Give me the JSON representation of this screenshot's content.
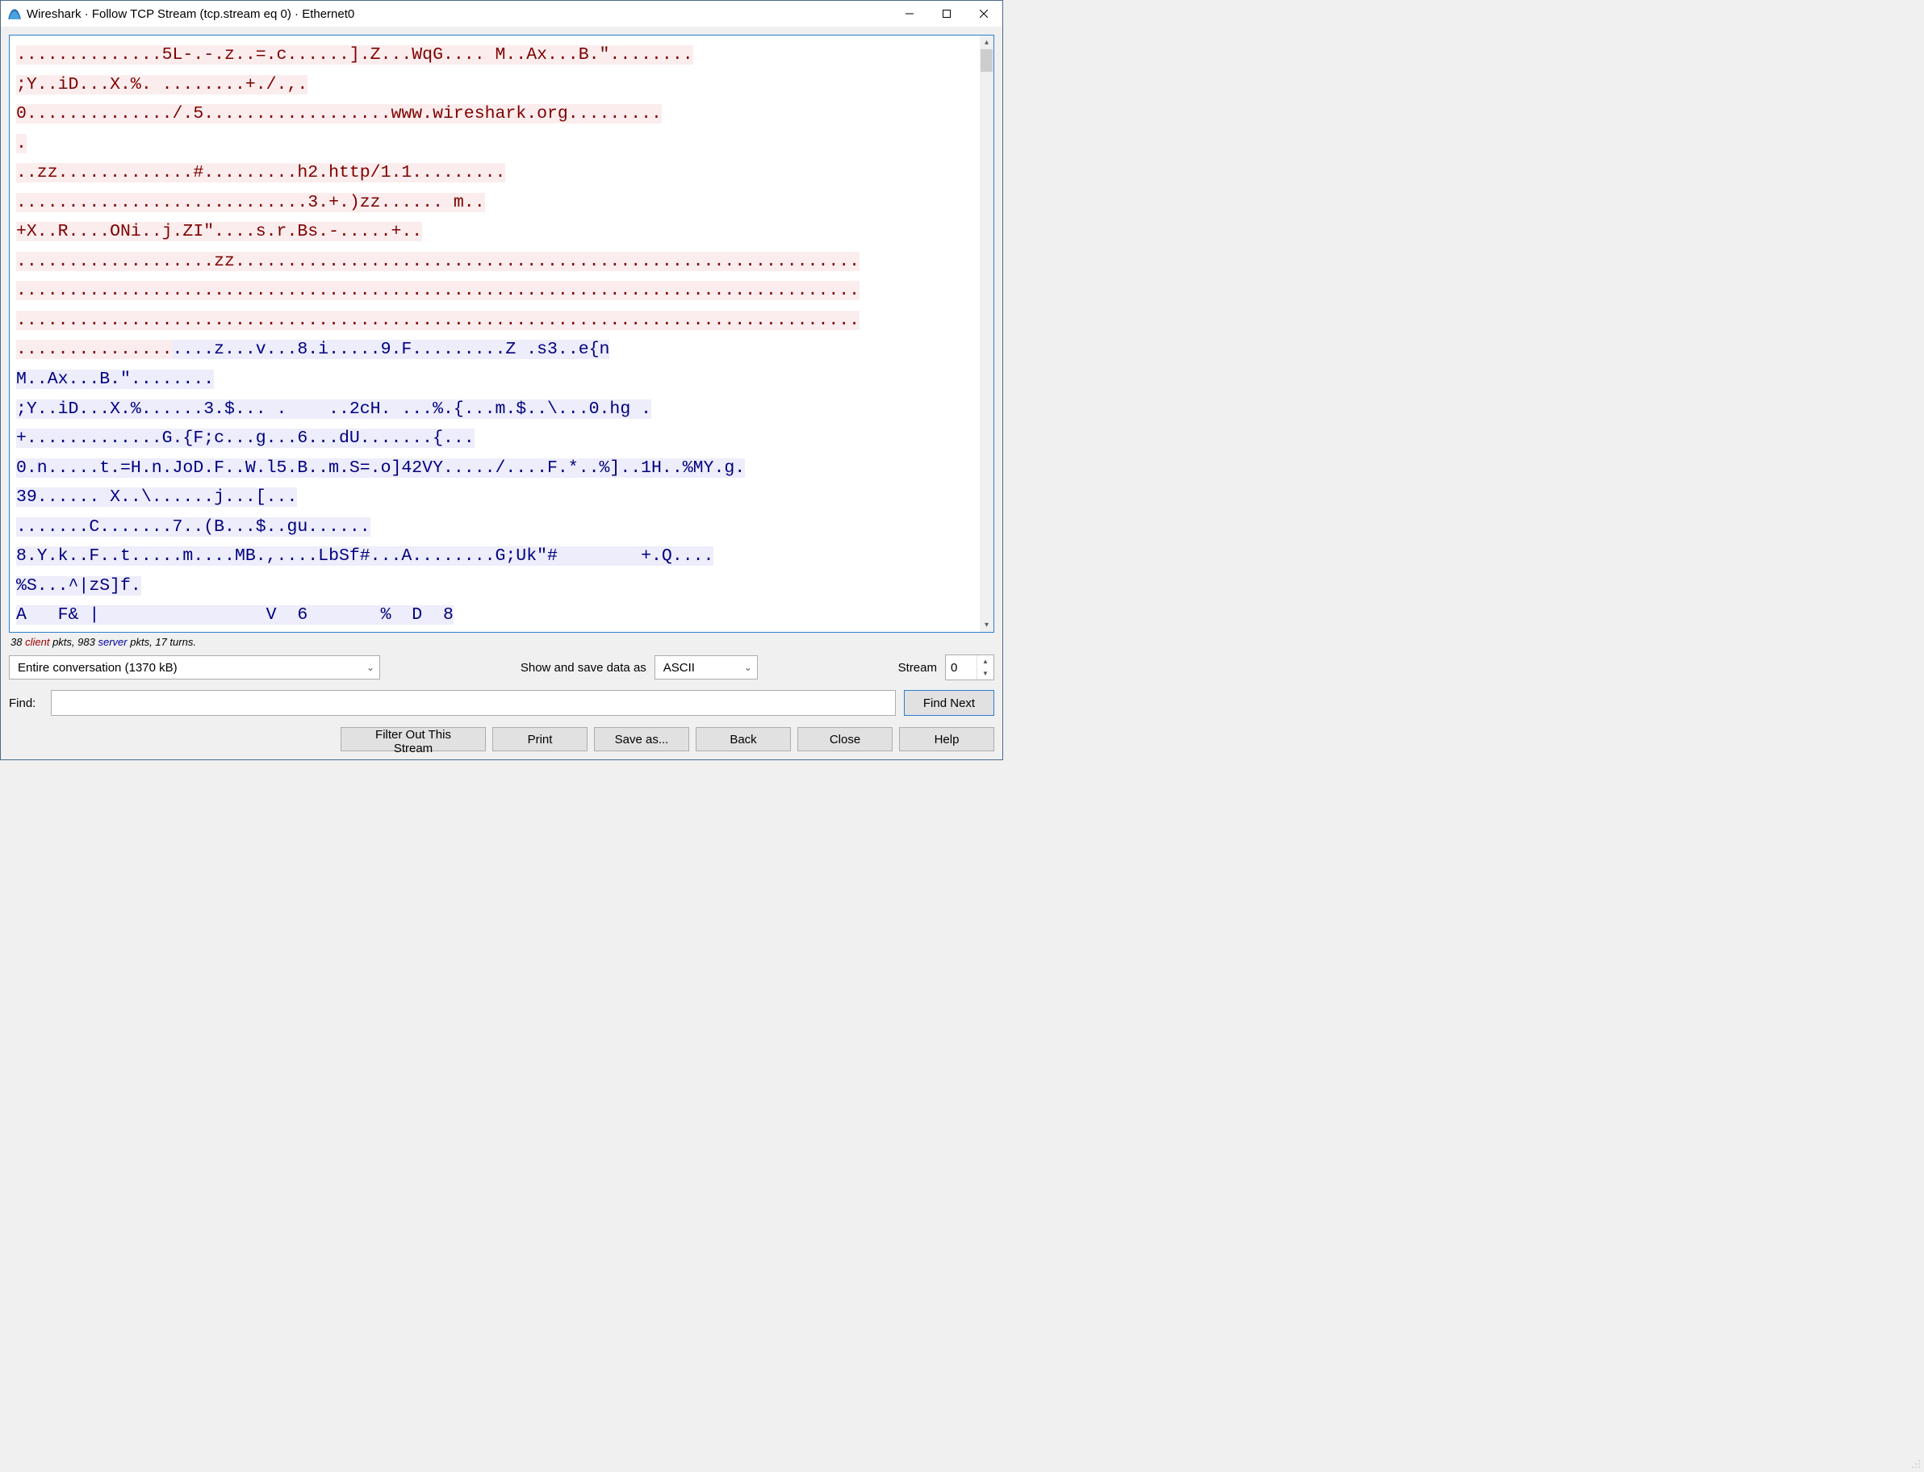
{
  "window": {
    "title": "Wireshark · Follow TCP Stream (tcp.stream eq 0) · Ethernet0"
  },
  "stream_segments": [
    {
      "dir": "c",
      "text": "..............5L-.-.z..=.c......].Z...WqG.... M..Ax...B.\"........"
    },
    {
      "dir": "br"
    },
    {
      "dir": "c",
      "text": ";Y..iD...X.%. ........+./.,."
    },
    {
      "dir": "br"
    },
    {
      "dir": "c",
      "text": "0............../.5..................www.wireshark.org........."
    },
    {
      "dir": "br"
    },
    {
      "dir": "c",
      "text": "."
    },
    {
      "dir": "br"
    },
    {
      "dir": "c",
      "text": "..zz.............#.........h2.http/1.1........."
    },
    {
      "dir": "br"
    },
    {
      "dir": "c",
      "text": "............................3.+.)zz...... m.."
    },
    {
      "dir": "br"
    },
    {
      "dir": "c",
      "text": "+X..R....ONi..j.ZI\"....s.r.Bs.-.....+.."
    },
    {
      "dir": "br"
    },
    {
      "dir": "c",
      "text": "...................zz............................................................"
    },
    {
      "dir": "br"
    },
    {
      "dir": "c",
      "text": "................................................................................."
    },
    {
      "dir": "br"
    },
    {
      "dir": "c",
      "text": "................................................................................."
    },
    {
      "dir": "br"
    },
    {
      "dir": "c",
      "text": "..............."
    },
    {
      "dir": "s",
      "text": "....z...v...8.i.....9.F.........Z .s3..e{n"
    },
    {
      "dir": "br"
    },
    {
      "dir": "s",
      "text": "M..Ax...B.\"........"
    },
    {
      "dir": "br"
    },
    {
      "dir": "s",
      "text": ";Y..iD...X.%......3.$... .    ..2cH. ...%.{...m.$..\\...0.hg ."
    },
    {
      "dir": "br"
    },
    {
      "dir": "s",
      "text": "+.............G.{F;c...g...6...dU.......{..."
    },
    {
      "dir": "br"
    },
    {
      "dir": "s",
      "text": "0.n.....t.=H.n.JoD.F..W.l5.B..m.S=.o]42VY...../....F.*..%]..1H..%MY.g."
    },
    {
      "dir": "br"
    },
    {
      "dir": "s",
      "text": "39...... X..\\......j...[..."
    },
    {
      "dir": "br"
    },
    {
      "dir": "s",
      "text": ".......C.......7..(B...$..gu......"
    },
    {
      "dir": "br"
    },
    {
      "dir": "s",
      "text": "8.Y.k..F..t.....m....MB.,....LbSf#...A........G;Uk\"#        +.Q...."
    },
    {
      "dir": "br"
    },
    {
      "dir": "s",
      "text": "%S...^|zS]f."
    },
    {
      "dir": "br"
    },
    {
      "dir": "s",
      "text": "A   F& |                V  6       %  D  8"
    }
  ],
  "stats": {
    "client_pkts": "38",
    "client_word": "client",
    "mid1": "pkts,",
    "server_pkts": "983",
    "server_word": "server",
    "mid2": "pkts,",
    "turns": "17 turns."
  },
  "controls": {
    "conv_filter": "Entire conversation (1370 kB)",
    "show_label": "Show and save data as",
    "format": "ASCII",
    "stream_label": "Stream",
    "stream_no": "0",
    "find_label": "Find:",
    "find_value": "",
    "find_next": "Find Next",
    "filter_out": "Filter Out This Stream",
    "print": "Print",
    "save_as": "Save as...",
    "back": "Back",
    "close": "Close",
    "help": "Help"
  }
}
